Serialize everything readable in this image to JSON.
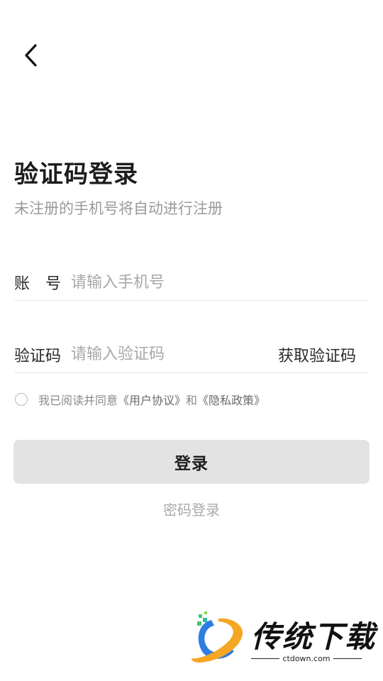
{
  "header": {
    "back_icon": "chevron-left-icon"
  },
  "login": {
    "title": "验证码登录",
    "subtitle": "未注册的手机号将自动进行注册"
  },
  "phone_field": {
    "label": "账号",
    "placeholder": "请输入手机号",
    "value": ""
  },
  "code_field": {
    "label": "验证码",
    "placeholder": "请输入验证码",
    "value": "",
    "get_code_label": "获取验证码"
  },
  "agreement": {
    "checked": false,
    "prefix": "我已阅读并同意",
    "user_agreement": "《用户协议》",
    "conjunction": "和",
    "privacy_policy": "《隐私政策》"
  },
  "actions": {
    "login_label": "登录",
    "password_login_label": "密码登录"
  },
  "watermark": {
    "brand": "传统下载",
    "domain": "ctdown.com"
  },
  "colors": {
    "login_button_bg": "#e3e3e3",
    "subtitle": "#9a9a9a",
    "placeholder": "#a8a8a8",
    "watermark_blue": "#2f7de1",
    "watermark_orange": "#f5a623",
    "watermark_green": "#3cc77a"
  }
}
